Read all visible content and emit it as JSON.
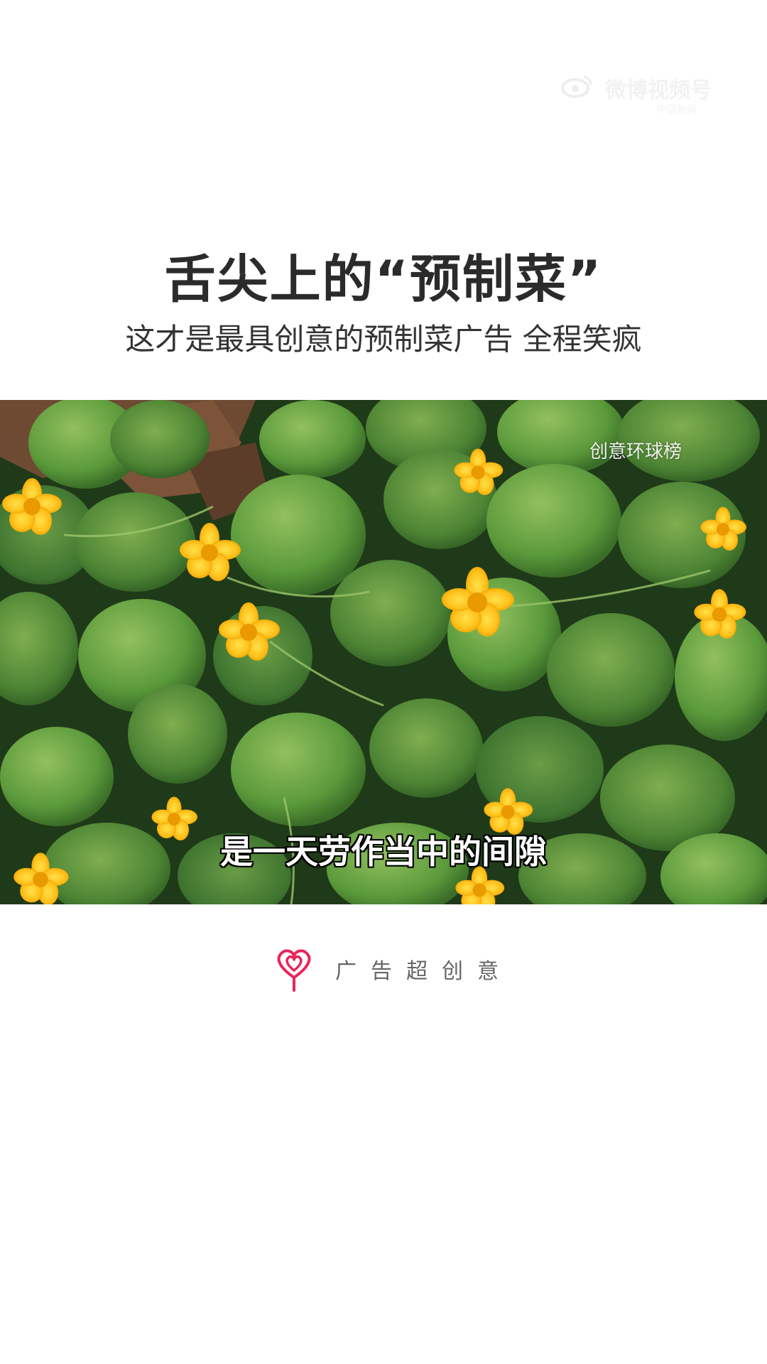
{
  "watermark": {
    "name": "微博视频号",
    "sub": "中国新闻"
  },
  "header": {
    "title": "舌尖上的“预制菜”",
    "subtitle": "这才是最具创意的预制菜广告 全程笑疯"
  },
  "video": {
    "channel_watermark": "创意环球榜",
    "caption": "是一天劳作当中的间隙"
  },
  "brand": {
    "name": "广告超创意",
    "logo_icon": "heart-lollipop-icon",
    "logo_color": "#e8245a"
  }
}
